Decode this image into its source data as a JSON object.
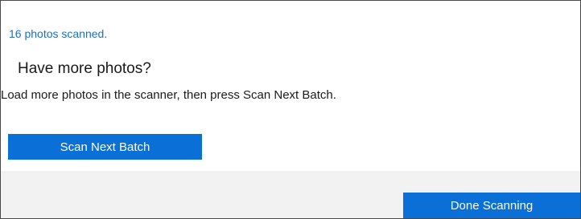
{
  "status": {
    "scanned_text": "16 photos scanned."
  },
  "prompt": {
    "heading": "Have more photos?",
    "instruction": "Load more photos in the scanner, then press Scan Next Batch."
  },
  "actions": {
    "scan_next_label": "Scan Next Batch",
    "done_label": "Done Scanning"
  },
  "colors": {
    "accent": "#0a6fd6",
    "status_text": "#1d6fc4",
    "footer_bg": "#f2f2f2"
  }
}
